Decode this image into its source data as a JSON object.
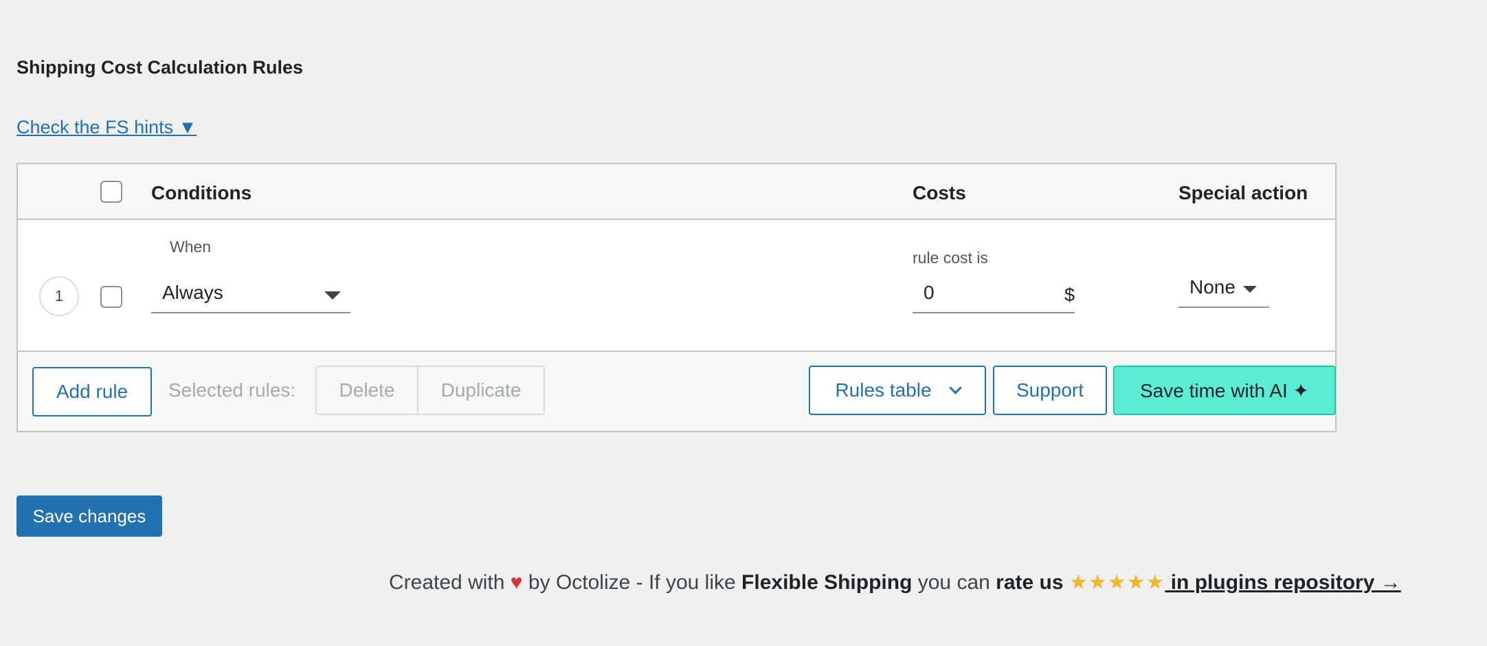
{
  "section": {
    "title": "Shipping Cost Calculation Rules",
    "hints_link": "Check the FS hints ▼"
  },
  "table": {
    "headers": {
      "conditions": "Conditions",
      "costs": "Costs",
      "special_action": "Special action"
    },
    "rows": [
      {
        "number": "1",
        "condition_label": "When",
        "condition_value": "Always",
        "cost_label": "rule cost is",
        "cost_value": "0",
        "currency": "$",
        "special_action": "None"
      }
    ]
  },
  "footer_bar": {
    "add_rule": "Add rule",
    "selected_rules_label": "Selected rules:",
    "delete": "Delete",
    "duplicate": "Duplicate",
    "rules_table": "Rules table",
    "support": "Support",
    "save_time_ai": "Save time with AI ✦"
  },
  "save_changes": "Save changes",
  "credits": {
    "created_with": "Created with",
    "heart": "♥",
    "by": "by Octolize - If you like",
    "plugin_name": "Flexible Shipping",
    "you_can": "you can",
    "rate_us": "rate us",
    "stars": "★★★★★",
    "repo_link": " in plugins repository →"
  },
  "colors": {
    "primary": "#2271b1",
    "ai_button": "#5cecd4",
    "stars": "#f0b72f",
    "heart": "#d63638"
  }
}
